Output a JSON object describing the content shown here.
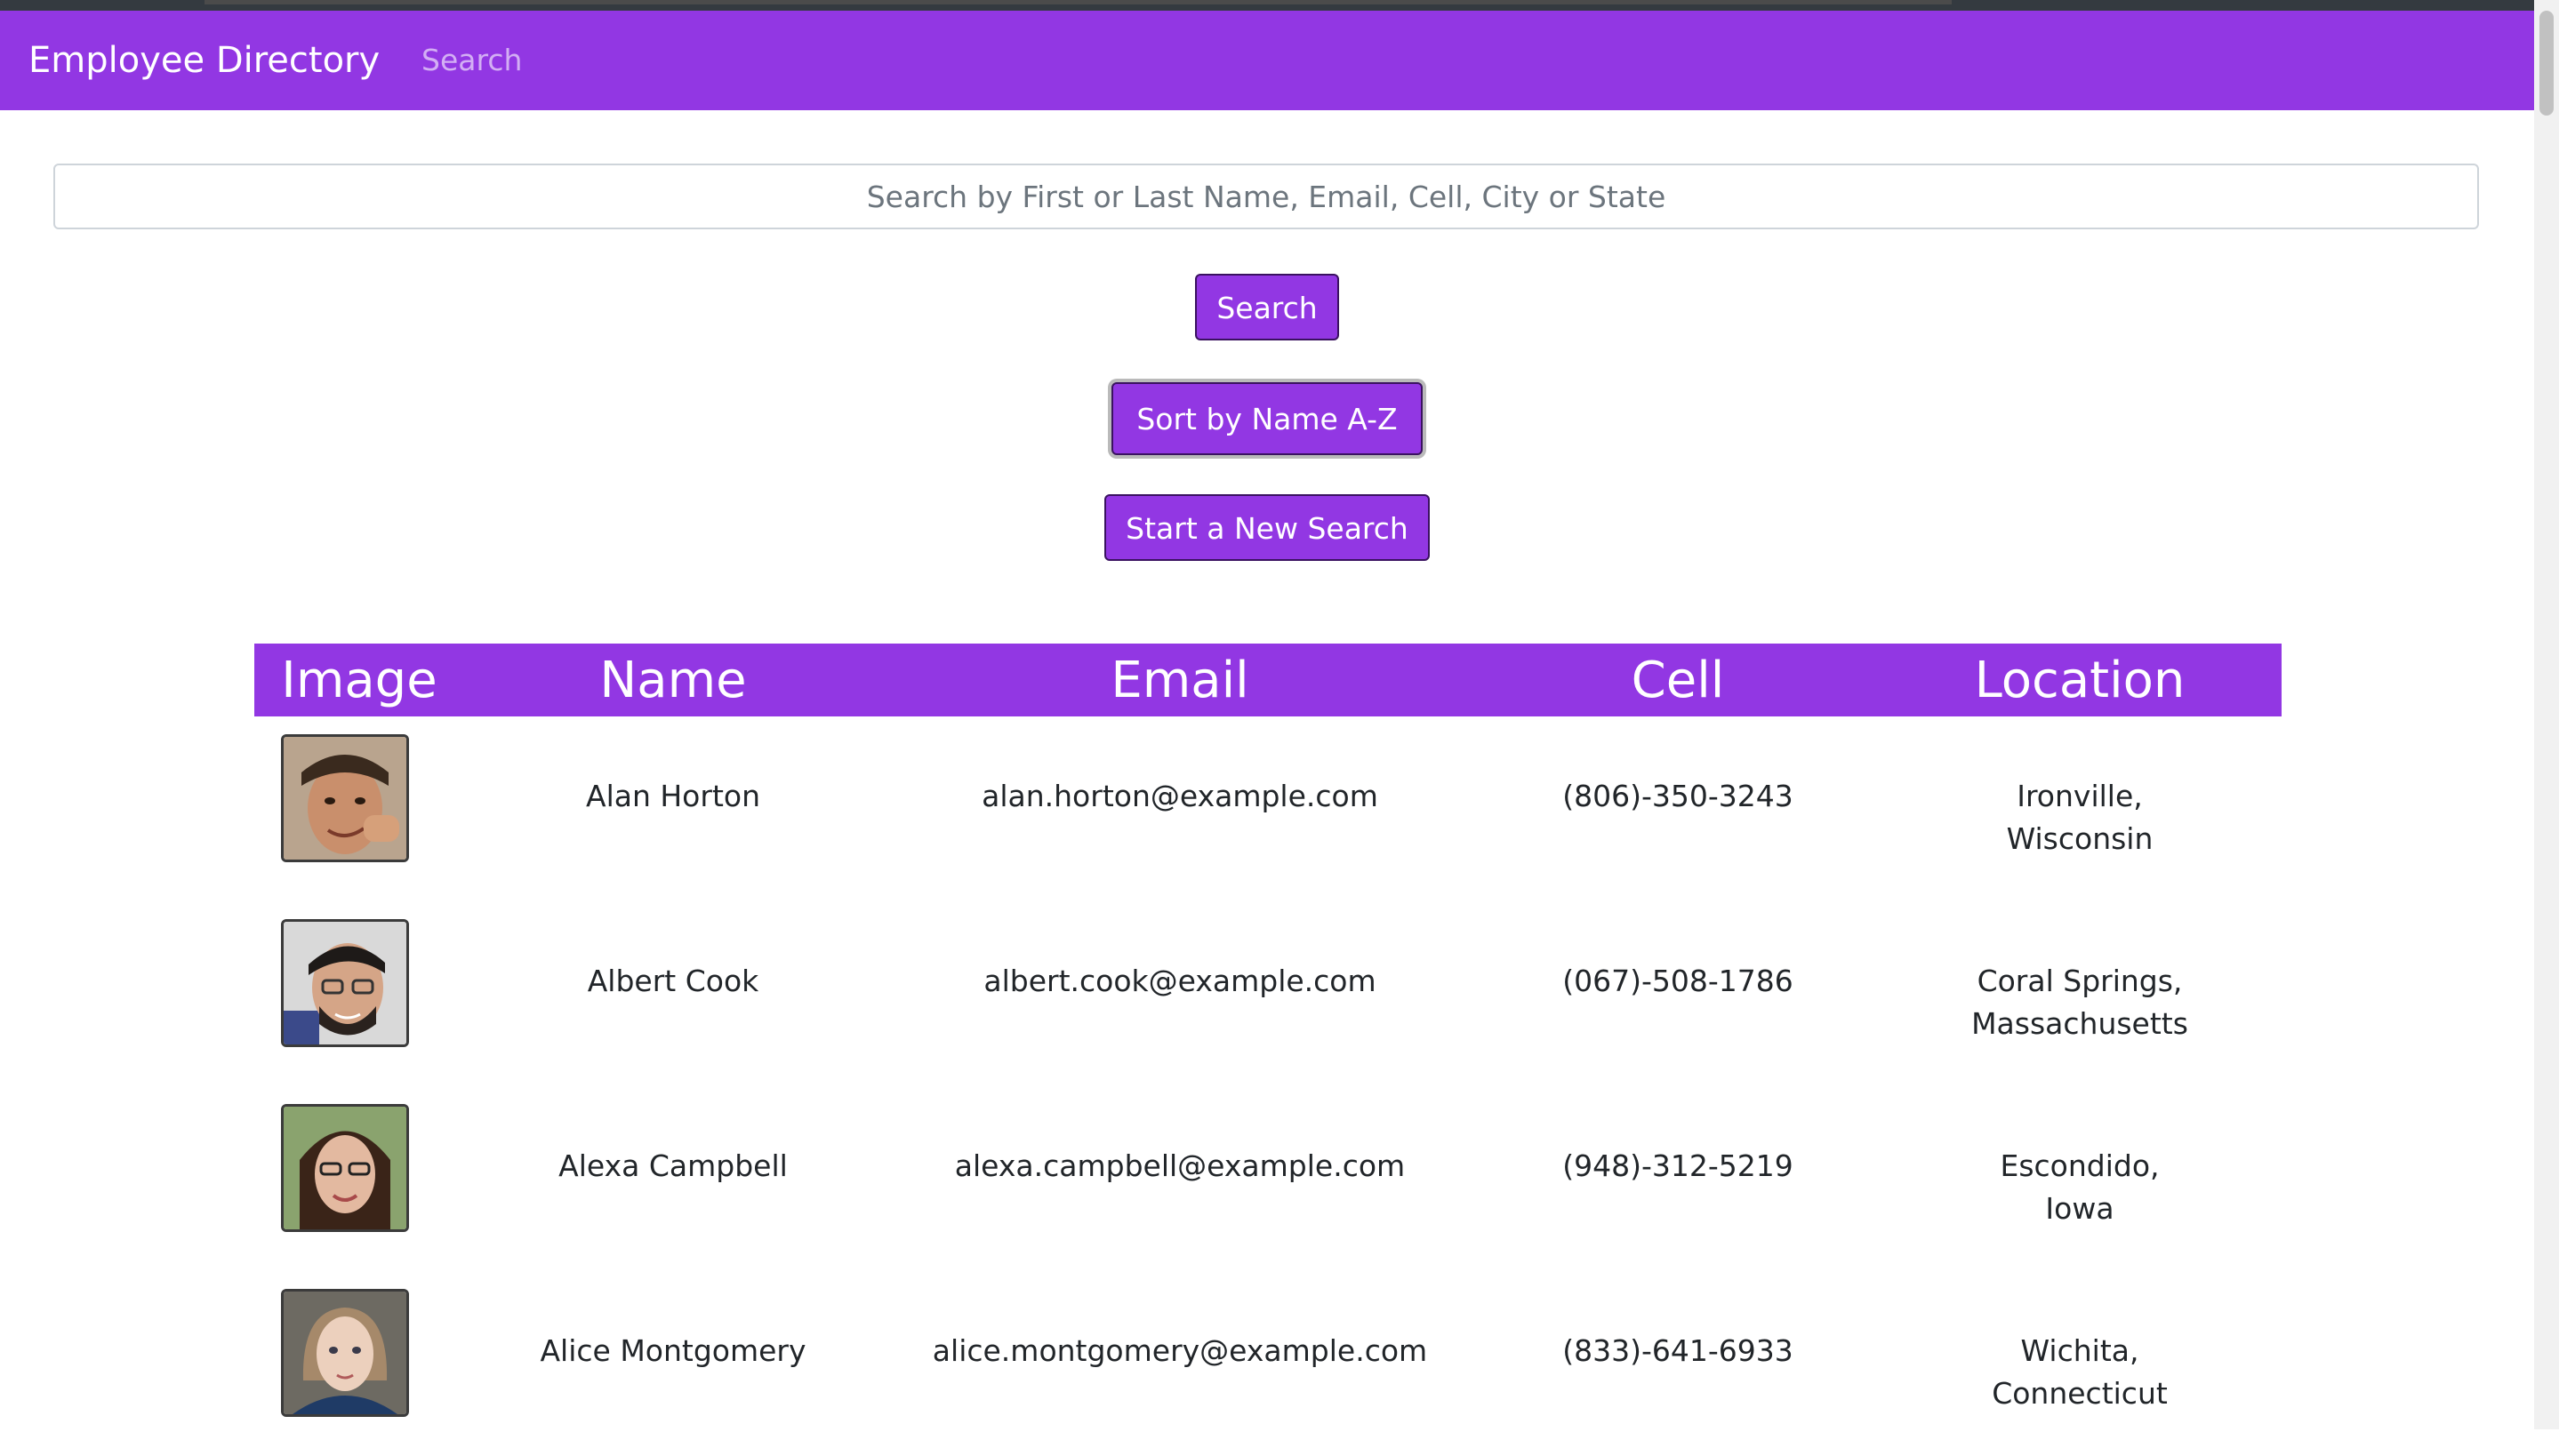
{
  "navbar": {
    "brand": "Employee Directory",
    "link": "Search"
  },
  "search": {
    "placeholder": "Search by First or Last Name, Email, Cell, City or State",
    "value": ""
  },
  "buttons": {
    "search": "Search",
    "sort": "Sort by Name A-Z",
    "new_search": "Start a New Search"
  },
  "colors": {
    "accent": "#9237e3"
  },
  "table": {
    "headers": {
      "image": "Image",
      "name": "Name",
      "email": "Email",
      "cell": "Cell",
      "location": "Location"
    },
    "rows": [
      {
        "name": "Alan Horton",
        "email": "alan.horton@example.com",
        "cell": "(806)-350-3243",
        "city": "Ironville,",
        "state": "Wisconsin",
        "image": "employee-photo"
      },
      {
        "name": "Albert Cook",
        "email": "albert.cook@example.com",
        "cell": "(067)-508-1786",
        "city": "Coral Springs,",
        "state": "Massachusetts",
        "image": "employee-photo"
      },
      {
        "name": "Alexa Campbell",
        "email": "alexa.campbell@example.com",
        "cell": "(948)-312-5219",
        "city": "Escondido,",
        "state": "Iowa",
        "image": "employee-photo"
      },
      {
        "name": "Alice Montgomery",
        "email": "alice.montgomery@example.com",
        "cell": "(833)-641-6933",
        "city": "Wichita,",
        "state": "Connecticut",
        "image": "employee-photo"
      }
    ]
  }
}
